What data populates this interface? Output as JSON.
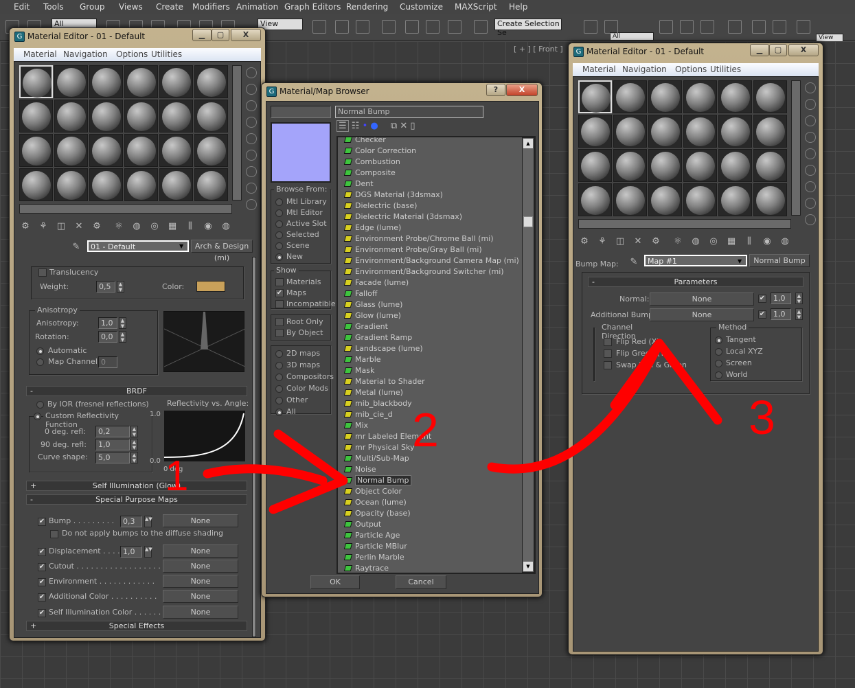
{
  "menubar": [
    "Edit",
    "Tools",
    "Group",
    "Views",
    "Create",
    "Modifiers",
    "Animation",
    "Graph Editors",
    "Rendering",
    "Customize",
    "MAXScript",
    "Help"
  ],
  "toolbar": {
    "selection_filter": "All",
    "ref_coord": "View",
    "named_selection": "Create Selection Se",
    "selection_filter_2": "All",
    "ref_coord_2": "View"
  },
  "viewport": {
    "front_label": "[ + ] [ Front ]"
  },
  "left_editor": {
    "title": "Material Editor - 01 - Default",
    "menu": [
      "Material",
      "Navigation",
      "Options",
      "Utilities"
    ],
    "material_name": "01 - Default",
    "material_type": "Arch & Design (mi)",
    "translucency": {
      "label": "Translucency",
      "weight_label": "Weight:",
      "weight": "0,5",
      "color_label": "Color:",
      "color": "#c9a15a"
    },
    "anisotropy": {
      "group": "Anisotropy",
      "anisotropy_label": "Anisotropy:",
      "anisotropy": "1,0",
      "rotation_label": "Rotation:",
      "rotation": "0,0",
      "automatic": "Automatic",
      "map_channel_label": "Map Channel:",
      "map_channel": "0"
    },
    "brdf": {
      "title": "BRDF",
      "by_ior": "By IOR (fresnel reflections)",
      "custom": "Custom Reflectivity Function",
      "chart_label": "Reflectivity vs. Angle:",
      "y_max": "1.0",
      "y_min": "0.0",
      "x_min": "0 deg",
      "refl0_label": "0 deg. refl:",
      "refl0": "0,2",
      "refl90_label": "90 deg. refl:",
      "refl90": "1,0",
      "curve_label": "Curve shape:",
      "curve": "5,0"
    },
    "self_illum": "Self Illumination (Glow)",
    "special_maps": {
      "title": "Special Purpose Maps",
      "rows": [
        {
          "label": "Bump . . . . . . . . .",
          "amount": "0,3",
          "map": "None"
        },
        {
          "label": "Displacement . . . .",
          "amount": "1,0",
          "map": "None"
        },
        {
          "label": "Cutout . . . . . . . . . . . . . . . . . .",
          "map": "None"
        },
        {
          "label": "Environment . . . . . . . . . . . .",
          "map": "None"
        },
        {
          "label": "Additional Color . . . . . . . . . .",
          "map": "None"
        },
        {
          "label": "Self Illumination Color . . . . . .",
          "map": "None"
        }
      ],
      "no_bump_diffuse": "Do not apply bumps to the diffuse shading"
    },
    "special_effects": "Special Effects"
  },
  "browser": {
    "title": "Material/Map Browser",
    "help": "?",
    "close": "X",
    "search": "Normal Bump",
    "preview_color": "#a4a4fa",
    "browse_from": {
      "label": "Browse From:",
      "options": [
        "Mtl Library",
        "Mtl Editor",
        "Active Slot",
        "Selected",
        "Scene",
        "New"
      ],
      "selected": "New"
    },
    "show": {
      "label": "Show",
      "options": [
        {
          "label": "Materials",
          "checked": false
        },
        {
          "label": "Maps",
          "checked": true
        },
        {
          "label": "Incompatible",
          "checked": false
        }
      ]
    },
    "root": [
      {
        "label": "Root Only",
        "checked": false
      },
      {
        "label": "By Object",
        "checked": false
      }
    ],
    "filters": {
      "options": [
        "2D maps",
        "3D maps",
        "Compositors",
        "Color Mods",
        "Other",
        "All"
      ],
      "selected": "All"
    },
    "items": [
      {
        "name": "Checker",
        "kind": "map"
      },
      {
        "name": "Color Correction",
        "kind": "map"
      },
      {
        "name": "Combustion",
        "kind": "map"
      },
      {
        "name": "Composite",
        "kind": "map"
      },
      {
        "name": "Dent",
        "kind": "map"
      },
      {
        "name": "DGS Material (3dsmax)",
        "kind": "mr"
      },
      {
        "name": "Dielectric (base)",
        "kind": "mr"
      },
      {
        "name": "Dielectric Material (3dsmax)",
        "kind": "mr"
      },
      {
        "name": "Edge (lume)",
        "kind": "mr"
      },
      {
        "name": "Environment Probe/Chrome Ball (mi)",
        "kind": "mr"
      },
      {
        "name": "Environment Probe/Gray Ball (mi)",
        "kind": "mr"
      },
      {
        "name": "Environment/Background Camera Map (mi)",
        "kind": "mr"
      },
      {
        "name": "Environment/Background Switcher (mi)",
        "kind": "mr"
      },
      {
        "name": "Facade (lume)",
        "kind": "mr"
      },
      {
        "name": "Falloff",
        "kind": "map"
      },
      {
        "name": "Glass (lume)",
        "kind": "mr"
      },
      {
        "name": "Glow (lume)",
        "kind": "mr"
      },
      {
        "name": "Gradient",
        "kind": "map"
      },
      {
        "name": "Gradient Ramp",
        "kind": "map"
      },
      {
        "name": "Landscape (lume)",
        "kind": "mr"
      },
      {
        "name": "Marble",
        "kind": "map"
      },
      {
        "name": "Mask",
        "kind": "map"
      },
      {
        "name": "Material to Shader",
        "kind": "mr"
      },
      {
        "name": "Metal (lume)",
        "kind": "mr"
      },
      {
        "name": "mib_blackbody",
        "kind": "mr"
      },
      {
        "name": "mib_cie_d",
        "kind": "mr"
      },
      {
        "name": "Mix",
        "kind": "map"
      },
      {
        "name": "mr Labeled Element",
        "kind": "mr"
      },
      {
        "name": "mr Physical Sky",
        "kind": "mr"
      },
      {
        "name": "Multi/Sub-Map",
        "kind": "map"
      },
      {
        "name": "Noise",
        "kind": "map"
      },
      {
        "name": "Normal Bump",
        "kind": "map",
        "selected": true
      },
      {
        "name": "Object Color",
        "kind": "mr"
      },
      {
        "name": "Ocean (lume)",
        "kind": "mr"
      },
      {
        "name": "Opacity (base)",
        "kind": "mr"
      },
      {
        "name": "Output",
        "kind": "map"
      },
      {
        "name": "Particle Age",
        "kind": "map"
      },
      {
        "name": "Particle MBlur",
        "kind": "map"
      },
      {
        "name": "Perlin Marble",
        "kind": "map"
      },
      {
        "name": "Raytrace",
        "kind": "map"
      }
    ],
    "map_icon_color": "#3ec43e",
    "mr_icon_color": "#d8d020",
    "ok": "OK",
    "cancel": "Cancel"
  },
  "right_editor": {
    "title": "Material Editor - 01 - Default",
    "menu": [
      "Material",
      "Navigation",
      "Options",
      "Utilities"
    ],
    "bump_label": "Bump Map:",
    "map_name": "Map #1",
    "map_type": "Normal Bump",
    "params": {
      "title": "Parameters",
      "normal_label": "Normal:",
      "normal_map": "None",
      "normal_amount": "1,0",
      "add_label": "Additional Bump:",
      "add_map": "None",
      "add_amount": "1,0",
      "channel": {
        "label": "Channel Direction",
        "options": [
          "Flip Red (X)",
          "Flip Green (Y)",
          "Swap Red & Green"
        ]
      },
      "method": {
        "label": "Method",
        "options": [
          "Tangent",
          "Local XYZ",
          "Screen",
          "World"
        ],
        "selected": "Tangent"
      }
    }
  },
  "annotations": {
    "color": "#ff0000",
    "steps": [
      "1",
      "2",
      "3"
    ]
  }
}
